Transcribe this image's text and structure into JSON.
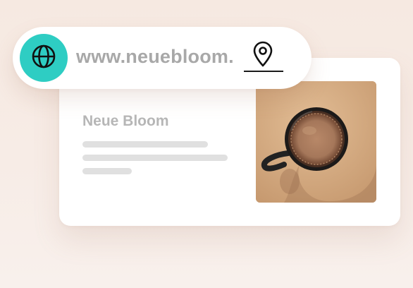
{
  "address_bar": {
    "url": "www.neuebloom.",
    "leading_icon": "globe-icon",
    "trailing_icon": "map-pin-icon"
  },
  "business_card": {
    "name": "Neue Bloom",
    "image": "coffee-cup-photo"
  },
  "colors": {
    "accent": "#2ecdc3",
    "background": "#f6e9e1",
    "card": "#ffffff",
    "muted_text": "#b6b6b6",
    "placeholder_line": "#e0e0e0"
  }
}
